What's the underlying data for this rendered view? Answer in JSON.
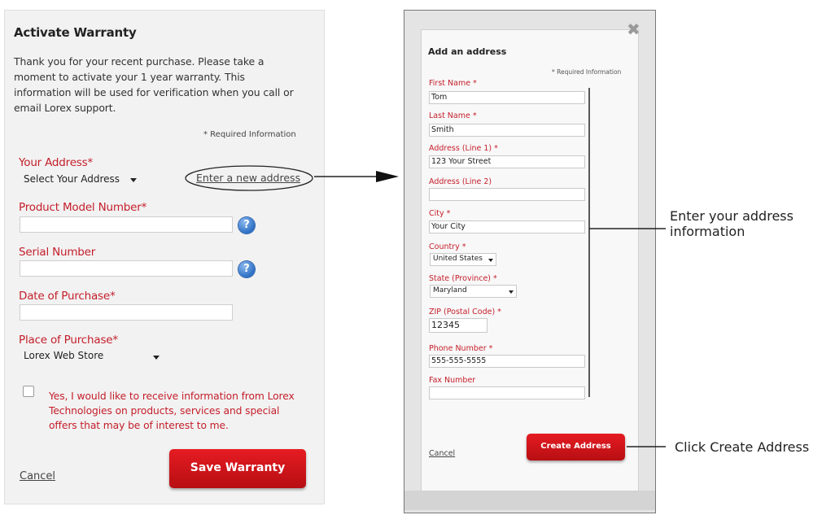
{
  "warranty_form": {
    "title": "Activate Warranty",
    "intro": "Thank you for your recent purchase. Please take a moment to activate your 1 year warranty. This information will be used for verification when you call or email Lorex support.",
    "required_note": "* Required Information",
    "address_label": "Your Address*",
    "address_select_value": "Select Your Address",
    "new_address_link": "Enter a new address",
    "model_label": "Product Model Number*",
    "model_value": "",
    "serial_label": "Serial Number",
    "serial_value": "",
    "date_label": "Date of Purchase*",
    "date_value": "",
    "place_label": "Place of Purchase*",
    "place_select_value": "Lorex Web Store",
    "consent_text": "Yes, I would like to receive information from Lorex Technologies on products, services and special offers that may be of interest to me.",
    "cancel_label": "Cancel",
    "save_label": "Save Warranty",
    "help_glyph": "?"
  },
  "address_modal": {
    "title": "Add an address",
    "required_note": "* Required Information",
    "close_glyph": "✖",
    "fields": {
      "first_name_label": "First Name *",
      "first_name_value": "Tom",
      "last_name_label": "Last Name *",
      "last_name_value": "Smith",
      "address1_label": "Address (Line 1) *",
      "address1_value": "123 Your Street",
      "address2_label": "Address (Line 2)",
      "address2_value": "",
      "city_label": "City *",
      "city_value": "Your City",
      "country_label": "Country *",
      "country_value": "United States",
      "state_label": "State (Province) *",
      "state_value": "Maryland",
      "zip_label": "ZIP (Postal Code) *",
      "zip_value": "12345",
      "phone_label": "Phone Number *",
      "phone_value": "555-555-5555",
      "fax_label": "Fax Number",
      "fax_value": ""
    },
    "cancel_label": "Cancel",
    "create_label": "Create Address"
  },
  "annotations": {
    "enter_info_line1": "Enter your address",
    "enter_info_line2": "information",
    "click_create": "Click Create Address"
  },
  "colors": {
    "brand_red": "#c41e2a",
    "button_red": "#d4151b",
    "help_blue": "#2d6fc4"
  },
  "icons": [
    "help-icon",
    "close-icon",
    "chevron-down-icon",
    "checkbox-icon"
  ]
}
